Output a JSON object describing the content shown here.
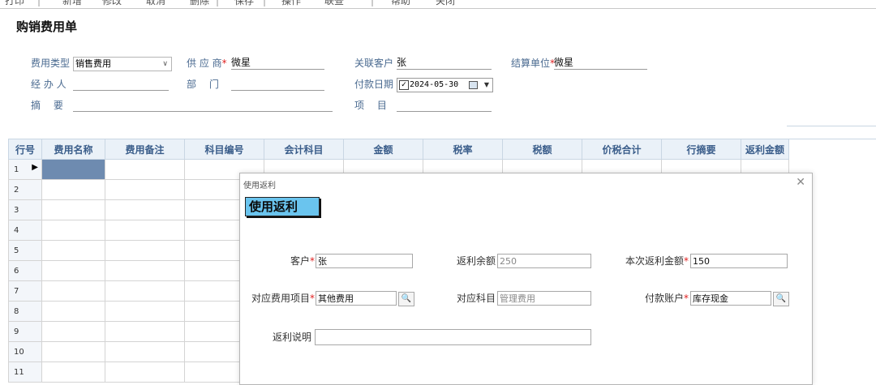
{
  "menu": [
    "打印",
    "新增",
    "修改",
    "取消",
    "删除",
    "保存",
    "操作",
    "联查",
    "帮助",
    "关闭"
  ],
  "doc_title": "购销费用单",
  "header": {
    "fee_type_label": "费用类型",
    "fee_type_value": "销售费用",
    "supplier_label": "供 应 商",
    "supplier_value": "微星",
    "related_customer_label": "关联客户",
    "related_customer_value": "张",
    "settlement_unit_label": "结算单位",
    "settlement_unit_value": "微星",
    "handler_label": "经 办 人",
    "handler_value": "",
    "dept_label": "部　 门",
    "dept_value": "",
    "payment_date_label": "付款日期",
    "payment_date_value": "2024-05-30",
    "summary_label": "摘　 要",
    "summary_value": "",
    "project_label": "项　 目",
    "project_value": ""
  },
  "grid": {
    "columns": [
      "行号",
      "费用名称",
      "费用备注",
      "科目编号",
      "会计科目",
      "金额",
      "税率",
      "税额",
      "价税合计",
      "行摘要",
      "返利金额"
    ],
    "rows": [
      "1",
      "2",
      "3",
      "4",
      "5",
      "6",
      "7",
      "8",
      "9",
      "10",
      "11"
    ]
  },
  "dialog": {
    "window_title": "使用返利",
    "heading": "使用返利",
    "close_glyph": "✕",
    "customer_label": "客户",
    "customer_value": "张",
    "rebate_balance_label": "返利余额",
    "rebate_balance_value": "250",
    "this_rebate_label": "本次返利金额",
    "this_rebate_value": "150",
    "fee_item_label": "对应费用项目",
    "fee_item_value": "其他费用",
    "subject_label": "对应科目",
    "subject_value": "管理费用",
    "pay_account_label": "付款账户",
    "pay_account_value": "库存现金",
    "rebate_note_label": "返利说明",
    "rebate_note_value": ""
  },
  "colors": {
    "header_text": "#3a5d8a",
    "dialog_heading_bg": "#6ac4ee",
    "required_mark": "#e02020",
    "current_cell": "#6e8bb0"
  }
}
